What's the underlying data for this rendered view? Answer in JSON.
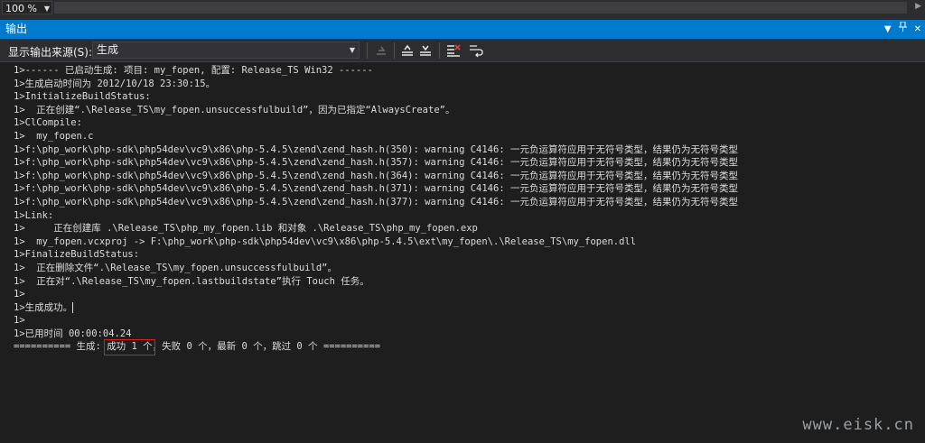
{
  "zoom": {
    "value": "100 %"
  },
  "panel": {
    "title": "输出"
  },
  "toolbar": {
    "source_label": "显示输出来源(S):",
    "source_value": "生成"
  },
  "output_lines": [
    "1>------ 已启动生成: 项目: my_fopen, 配置: Release_TS Win32 ------",
    "1>生成启动时间为 2012/10/18 23:30:15。",
    "1>InitializeBuildStatus:",
    "1>  正在创建“.\\Release_TS\\my_fopen.unsuccessfulbuild”，因为已指定“AlwaysCreate”。",
    "1>ClCompile:",
    "1>  my_fopen.c",
    "1>f:\\php_work\\php-sdk\\php54dev\\vc9\\x86\\php-5.4.5\\zend\\zend_hash.h(350): warning C4146: 一元负运算符应用于无符号类型，结果仍为无符号类型",
    "1>f:\\php_work\\php-sdk\\php54dev\\vc9\\x86\\php-5.4.5\\zend\\zend_hash.h(357): warning C4146: 一元负运算符应用于无符号类型，结果仍为无符号类型",
    "1>f:\\php_work\\php-sdk\\php54dev\\vc9\\x86\\php-5.4.5\\zend\\zend_hash.h(364): warning C4146: 一元负运算符应用于无符号类型，结果仍为无符号类型",
    "1>f:\\php_work\\php-sdk\\php54dev\\vc9\\x86\\php-5.4.5\\zend\\zend_hash.h(371): warning C4146: 一元负运算符应用于无符号类型，结果仍为无符号类型",
    "1>f:\\php_work\\php-sdk\\php54dev\\vc9\\x86\\php-5.4.5\\zend\\zend_hash.h(377): warning C4146: 一元负运算符应用于无符号类型，结果仍为无符号类型",
    "1>Link:",
    "1>     正在创建库 .\\Release_TS\\php_my_fopen.lib 和对象 .\\Release_TS\\php_my_fopen.exp",
    "1>  my_fopen.vcxproj -> F:\\php_work\\php-sdk\\php54dev\\vc9\\x86\\php-5.4.5\\ext\\my_fopen\\.\\Release_TS\\my_fopen.dll",
    "1>FinalizeBuildStatus:",
    "1>  正在删除文件“.\\Release_TS\\my_fopen.unsuccessfulbuild”。",
    "1>  正在对“.\\Release_TS\\my_fopen.lastbuildstate”执行 Touch 任务。",
    "1>",
    "1>生成成功。",
    "1>",
    "1>已用时间 00:00:04.24"
  ],
  "summary": {
    "prefix": "========== 生成: ",
    "success": "成功 1 个",
    "rest": "，失败 0 个，最新 0 个，跳过 0 个 =========="
  },
  "watermark": "www.eisk.cn",
  "colors": {
    "accent": "#007acc",
    "highlight_box": "#e01b1b"
  }
}
